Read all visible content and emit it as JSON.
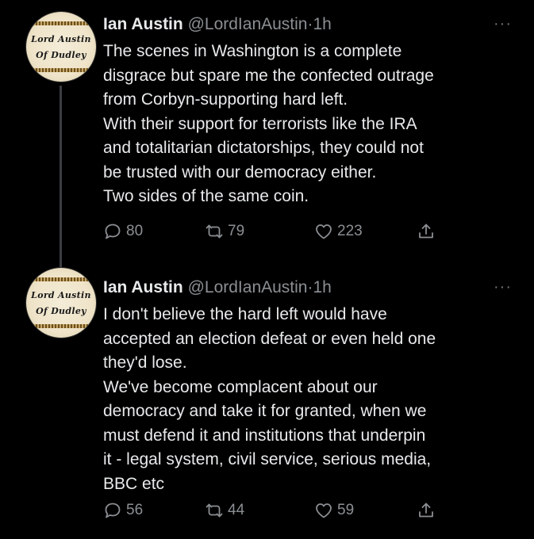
{
  "tweets": [
    {
      "avatar": {
        "line1": "Lord Austin",
        "line2": "Of Dudley"
      },
      "author_name": "Ian Austin",
      "handle": "@LordIanAustin",
      "separator": "·",
      "time": "1h",
      "more_icon": "ellipsis-icon",
      "more_label": "···",
      "lines": [
        "The scenes in Washington is a complete",
        "disgrace but spare me the confected outrage",
        "from Corbyn-supporting hard left.",
        "With their support for terrorists like the IRA",
        "and totalitarian dictatorships, they could not",
        "be trusted with our democracy either.",
        "Two sides of the same coin."
      ],
      "replies": "80",
      "retweets": "79",
      "likes": "223"
    },
    {
      "avatar": {
        "line1": "Lord Austin",
        "line2": "Of Dudley"
      },
      "author_name": "Ian Austin",
      "handle": "@LordIanAustin",
      "separator": "·",
      "time": "1h",
      "more_icon": "ellipsis-icon",
      "more_label": "···",
      "lines": [
        "I don't believe the hard left would have",
        "accepted an election defeat or even held one",
        "they'd lose.",
        "We've become complacent about our",
        "democracy and take it for granted, when we",
        "must defend it and institutions that underpin",
        "it - legal system, civil service, serious media,",
        "BBC etc"
      ],
      "replies": "56",
      "retweets": "44",
      "likes": "59"
    }
  ],
  "icons": {
    "reply": "reply-bubble-icon",
    "retweet": "retweet-arrows-icon",
    "like": "heart-icon",
    "share": "share-upload-icon"
  },
  "colors": {
    "background": "#000000",
    "text": "#e7e9ea",
    "muted": "#8b8f93",
    "thread_line": "#3a3d40"
  }
}
